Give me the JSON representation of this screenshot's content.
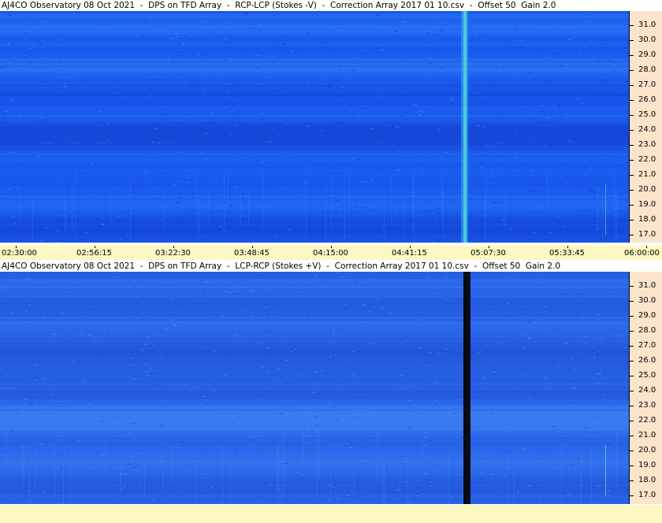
{
  "panels": [
    {
      "title": "AJ4CO Observatory 08 Oct 2021  -  DPS on TFD Array  -  RCP-LCP (Stokes -V)  -  Correction Array 2017 01 10.csv  -  Offset 50  Gain 2.0",
      "freq_ticks": [
        "31.0",
        "30.0",
        "29.0",
        "28.0",
        "27.0",
        "26.0",
        "25.0",
        "24.0",
        "23.0",
        "22.0",
        "21.0",
        "20.0",
        "19.0",
        "18.0",
        "17.0"
      ],
      "time_ticks": [
        "02:30:00",
        "02:56:15",
        "03:22:30",
        "03:48:45",
        "04:15:00",
        "04:41:15",
        "05:07:30",
        "05:33:45",
        "06:00:00"
      ],
      "palette": {
        "base": "#1a5cf0",
        "dark": "#1236c4",
        "light": "#3a8bf6",
        "spike": "#4fd3d8"
      },
      "event": {
        "type": "broadband-spike",
        "time": "05:07:30",
        "color": "cyan"
      }
    },
    {
      "title": "AJ4CO Observatory 08 Oct 2021  -  DPS on TFD Array  -  LCP-RCP (Stokes +V)  -  Correction Array 2017 01 10.csv  -  Offset 50  Gain 2.0",
      "freq_ticks": [
        "31.0",
        "30.0",
        "29.0",
        "28.0",
        "27.0",
        "26.0",
        "25.0",
        "24.0",
        "23.0",
        "22.0",
        "21.0",
        "20.0",
        "19.0",
        "18.0",
        "17.0"
      ],
      "time_ticks": [],
      "palette": {
        "base": "#2a66ea",
        "dark": "#1a46c8",
        "light": "#4b90f4",
        "spike": "#0a0a14"
      },
      "event": {
        "type": "broadband-spike",
        "time": "05:07:30",
        "color": "black"
      }
    }
  ]
}
